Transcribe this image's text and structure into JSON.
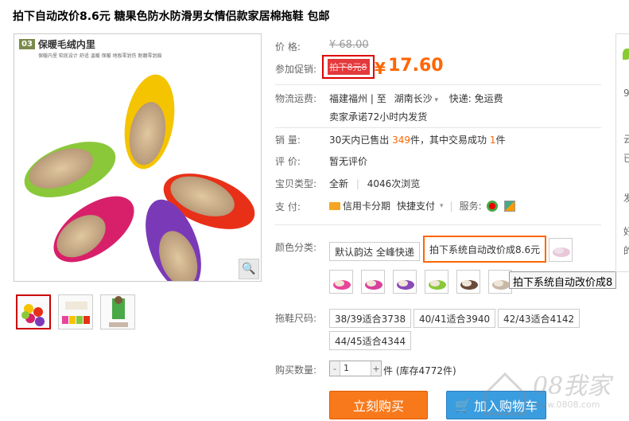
{
  "product": {
    "title": "拍下自动改价8.6元 糖果色防水防滑男女情侣款家居棉拖鞋 包邮"
  },
  "gallery": {
    "brand_num": "03",
    "brand_name": "保暖毛绒内里",
    "brand_sub": "保暖内里  软底设计  舒适  温暖  保暖  地板零划伤  耐磨零划痕"
  },
  "price": {
    "label": "价 格:",
    "old": "¥ 68.00",
    "promo_label": "参加促销:",
    "promo_tag": "拍下8元8",
    "currency": "¥",
    "current": "17.60"
  },
  "shipping": {
    "label": "物流运费:",
    "from": "福建福州",
    "sep": "|",
    "to_prefix": "至",
    "to": "湖南长沙",
    "express": "快递: 免运费",
    "promise": "卖家承诺72小时内发货"
  },
  "sales": {
    "label": "销 量:",
    "prefix": "30天内已售出",
    "count": "349",
    "mid": "件，其中交易成功",
    "success": "1",
    "suffix": "件"
  },
  "review": {
    "label": "评 价:",
    "value": "暂无评价"
  },
  "type": {
    "label": "宝贝类型:",
    "value": "全新",
    "views": "4046次浏览"
  },
  "payment": {
    "label": "支 付:",
    "credit": "信用卡分期",
    "quick": "快捷支付",
    "service": "服务:"
  },
  "color": {
    "label": "颜色分类:",
    "options": [
      "默认韵达 全峰快递",
      "拍下系统自动改价成8.6元"
    ],
    "tooltip": "拍下系统自动改价成8",
    "swatches": [
      "#e8459a",
      "#d8409c",
      "#8a4ab8",
      "#8ac83a",
      "#6a4a3a",
      "#c8b8a8"
    ],
    "first_swatch": "#e8c8d8"
  },
  "size": {
    "label": "拖鞋尺码:",
    "options": [
      "38/39适合3738",
      "40/41适合3940",
      "42/43适合4142",
      "44/45适合4344"
    ]
  },
  "quantity": {
    "label": "购买数量:",
    "value": "1",
    "minus": "-",
    "plus": "+",
    "stock": "件 (库存4772件)"
  },
  "actions": {
    "buy": "立刻购买",
    "cart": "加入购物车"
  },
  "side": {
    "chars": [
      "9",
      "云",
      "已",
      "发",
      "好",
      "的"
    ]
  },
  "watermark": {
    "text": "08我家",
    "url": "www.0808.com"
  },
  "colors": {
    "accent": "#f60",
    "promo": "#e4393c",
    "buy": "#f8791c",
    "cart": "#3a9de0"
  }
}
